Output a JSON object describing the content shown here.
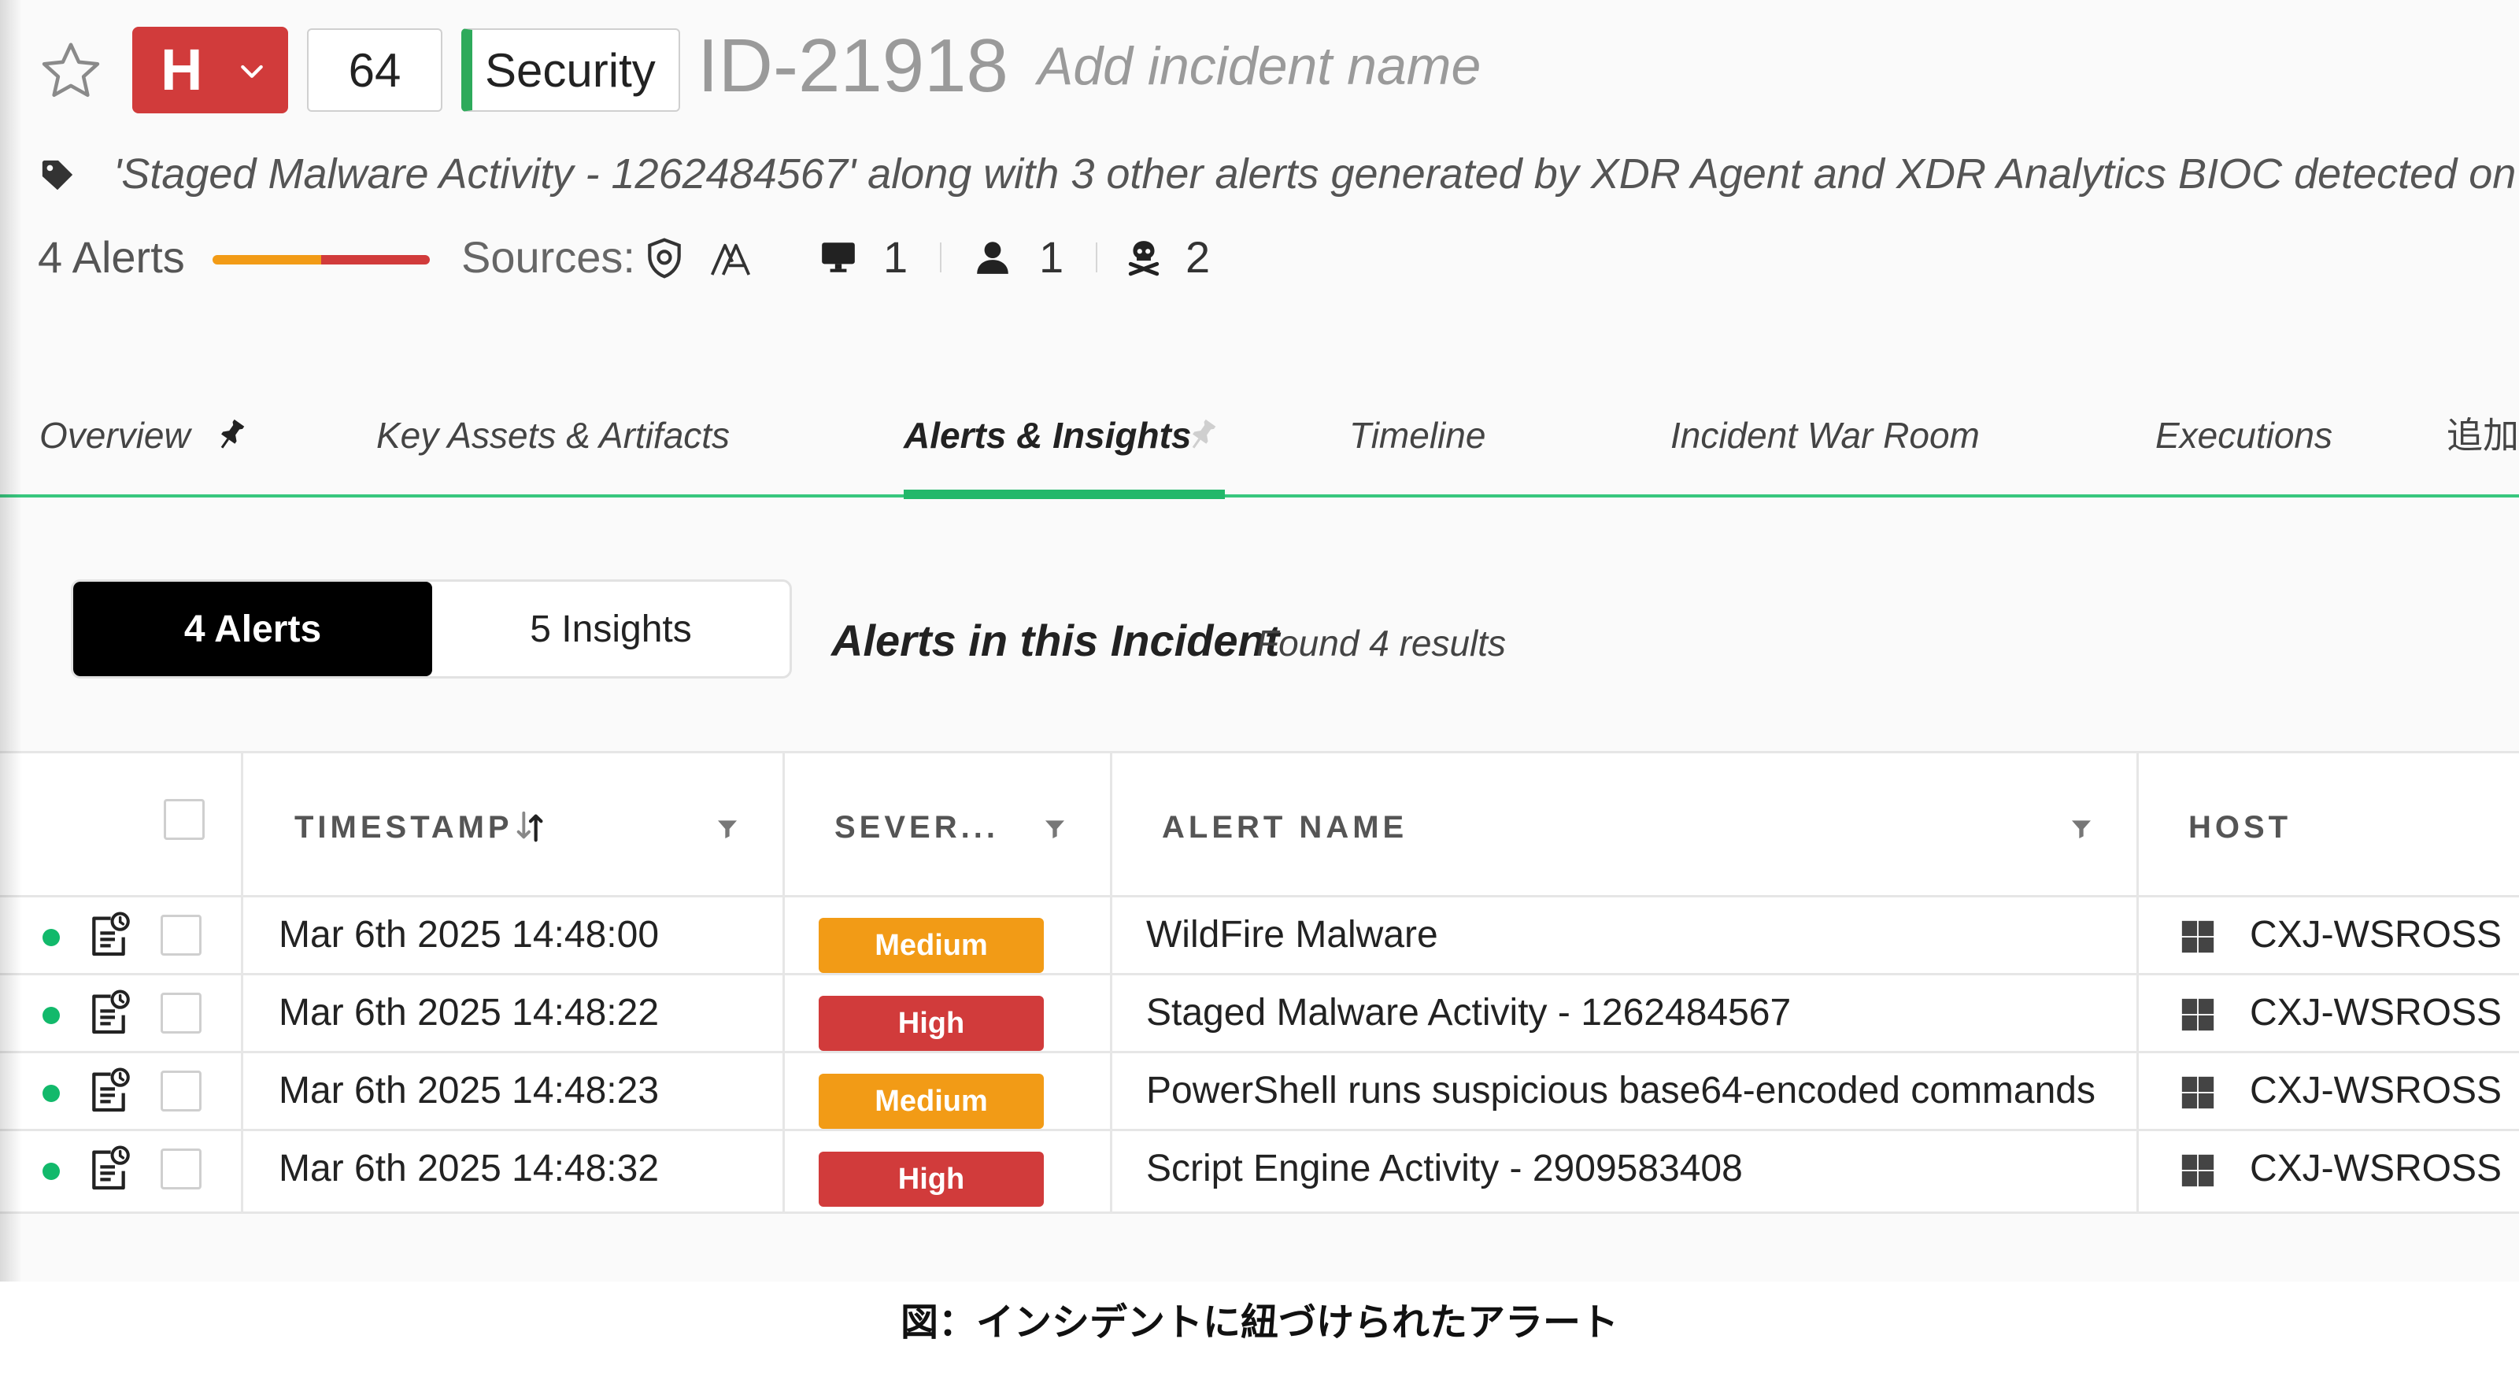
{
  "header": {
    "severity_letter": "H",
    "score": "64",
    "incident_type": "Security",
    "incident_id": "ID-21918",
    "incident_name_placeholder": "Add incident name",
    "description": "'Staged Malware Activity - 1262484567' along with 3 other alerts generated by XDR Agent and XDR Analytics BIOC detected on host",
    "alerts_count": "4 Alerts",
    "alert_severity_split": {
      "medium": 2,
      "high": 2
    },
    "sources_label": "Sources:",
    "hosts_count": "1",
    "users_count": "1",
    "malware_count": "2"
  },
  "tabs": [
    {
      "label": "Overview",
      "pinned": true
    },
    {
      "label": "Key Assets & Artifacts"
    },
    {
      "label": "Alerts & Insights",
      "active": true
    },
    {
      "label": "Timeline"
    },
    {
      "label": "Incident War Room"
    },
    {
      "label": "Executions"
    },
    {
      "label": "追加"
    }
  ],
  "toggle": {
    "alerts_label": "4 Alerts",
    "insights_label": "5 Insights"
  },
  "section": {
    "title": "Alerts in this Incident",
    "found": "Found 4 results"
  },
  "table": {
    "columns": [
      "TIMESTAMP",
      "SEVER...",
      "ALERT NAME",
      "HOST"
    ],
    "rows": [
      {
        "timestamp": "Mar 6th 2025 14:48:00",
        "severity": "Medium",
        "alert_name": "WildFire Malware",
        "host": "CXJ-WSROSS"
      },
      {
        "timestamp": "Mar 6th 2025 14:48:22",
        "severity": "High",
        "alert_name": "Staged Malware Activity - 1262484567",
        "host": "CXJ-WSROSS"
      },
      {
        "timestamp": "Mar 6th 2025 14:48:23",
        "severity": "Medium",
        "alert_name": "PowerShell runs suspicious base64-encoded commands",
        "host": "CXJ-WSROSS"
      },
      {
        "timestamp": "Mar 6th 2025 14:48:32",
        "severity": "High",
        "alert_name": "Script Engine Activity - 2909583408",
        "host": "CXJ-WSROSS"
      }
    ]
  },
  "caption": "図：インシデントに紐づけられたアラート",
  "colors": {
    "high": "#d13b3b",
    "medium": "#f29b16",
    "accent": "#22b86a",
    "status_dot": "#12b96b"
  }
}
